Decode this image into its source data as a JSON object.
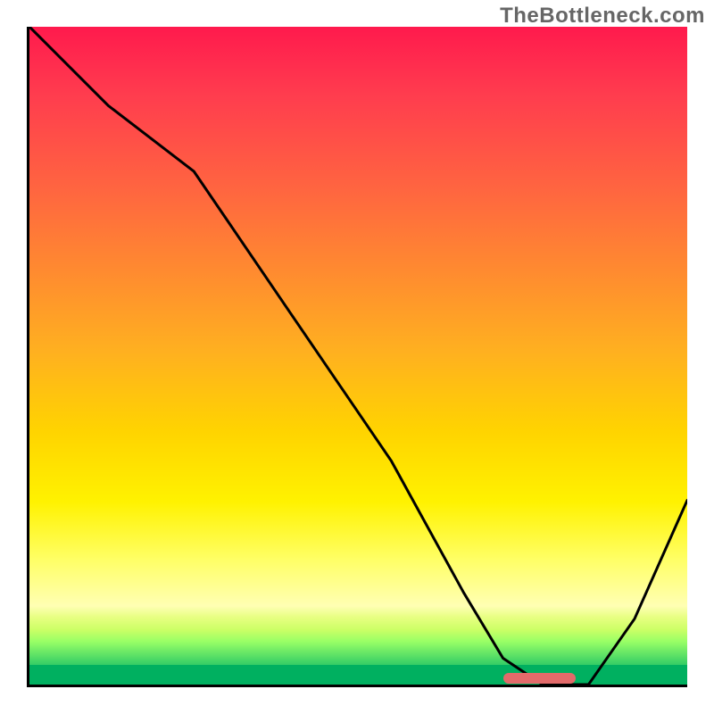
{
  "watermark": "TheBottleneck.com",
  "colors": {
    "curve": "#000000",
    "marker": "#e26a6a",
    "axis": "#000000"
  },
  "chart_data": {
    "type": "line",
    "title": "",
    "xlabel": "",
    "ylabel": "",
    "xlim": [
      0,
      100
    ],
    "ylim": [
      0,
      100
    ],
    "grid": false,
    "x": [
      0,
      12,
      25,
      40,
      55,
      66,
      72,
      78,
      85,
      92,
      100
    ],
    "values": [
      100,
      88,
      78,
      56,
      34,
      14,
      4,
      0,
      0,
      10,
      28
    ],
    "marker": {
      "x_start": 72,
      "x_end": 83,
      "y": 0
    },
    "background_gradient": [
      {
        "stop": 0,
        "color": "#ff1a4d"
      },
      {
        "stop": 30,
        "color": "#ff6540"
      },
      {
        "stop": 60,
        "color": "#ffd400"
      },
      {
        "stop": 85,
        "color": "#ffff66"
      },
      {
        "stop": 97,
        "color": "#66e666"
      },
      {
        "stop": 100,
        "color": "#00b060"
      }
    ]
  }
}
